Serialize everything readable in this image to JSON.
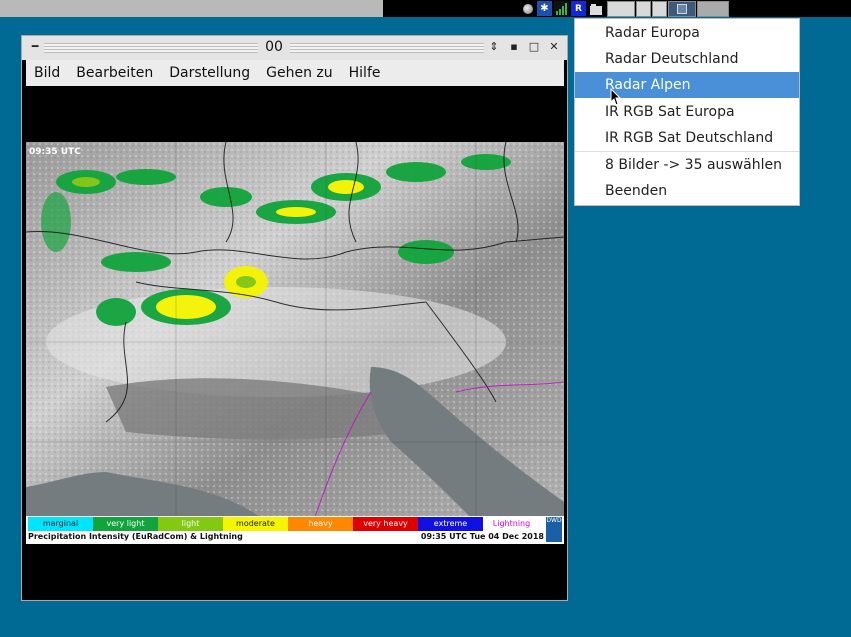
{
  "window": {
    "title": "00",
    "menu": [
      "Bild",
      "Bearbeiten",
      "Darstellung",
      "Gehen zu",
      "Hilfe"
    ]
  },
  "tray": {
    "r_label": "R"
  },
  "map": {
    "timestamp": "09:35 UTC",
    "legend": [
      {
        "label": "marginal",
        "color": "#00e5ff"
      },
      {
        "label": "very light",
        "color": "#11a43c"
      },
      {
        "label": "light",
        "color": "#83c811"
      },
      {
        "label": "moderate",
        "color": "#f5f500"
      },
      {
        "label": "heavy",
        "color": "#ff8800"
      },
      {
        "label": "very heavy",
        "color": "#e00000"
      },
      {
        "label": "extreme",
        "color": "#1010e0"
      },
      {
        "label": "Lightning",
        "color": "#e000e0"
      }
    ],
    "footer_left": "Precipitation Intensity (EuRadCom) & Lightning",
    "footer_right": "09:35 UTC Tue 04 Dec 2018",
    "logo": "DWD"
  },
  "context_menu": {
    "items": [
      "Radar Europa",
      "Radar Deutschland",
      "Radar Alpen",
      "IR RGB Sat Europa",
      "IR RGB Sat Deutschland",
      "8 Bilder -> 35 auswählen",
      "Beenden"
    ],
    "selected": "Radar Alpen"
  }
}
